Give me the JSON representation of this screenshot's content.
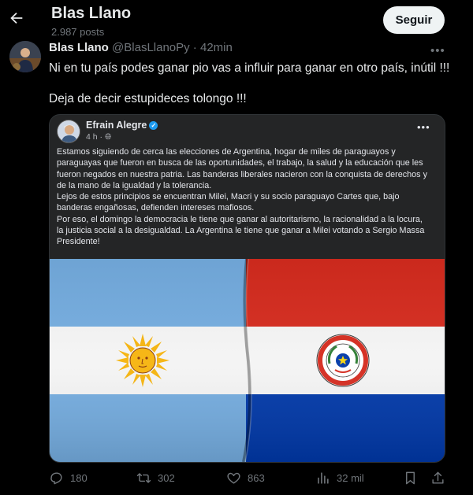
{
  "header": {
    "display_name": "Blas Llano",
    "post_count": "2.987 posts",
    "follow_label": "Seguir"
  },
  "tweet": {
    "author_name": "Blas Llano",
    "author_meta": "@BlasLlanoPy · 42min",
    "lines": [
      "Ni en tu país podes ganar pio vas a influir para ganar en otro país, inútil !!!",
      "Deja de decir estupideces tolongo !!!"
    ]
  },
  "embed": {
    "author_name": "Efrain Alegre",
    "time": "4 h · ",
    "lines": [
      "Estamos siguiendo de cerca las elecciones de Argentina, hogar de miles de paraguayos y",
      "paraguayas que fueron en busca de las oportunidades, el trabajo, la salud y la educación que les",
      "fueron negados en nuestra patria. Las banderas liberales nacieron con la conquista de derechos y",
      "de la mano de la igualdad y la tolerancia.",
      "Lejos de estos principios se encuentran Milei, Macri y su socio paraguayo Cartes que, bajo",
      "banderas engañosas, defienden intereses mafiosos.",
      "Por eso, el domingo la democracia le tiene que ganar al autoritarismo, la racionalidad a la locura,",
      "la justicia social a la desigualdad. La Argentina le tiene que ganar a Milei votando a Sergio Massa",
      "Presidente!"
    ],
    "seal_text": "REPUBLICA DEL PARAGUAY"
  },
  "actions": {
    "replies": "180",
    "reposts": "302",
    "likes": "863",
    "views": "32 mil"
  },
  "colors": {
    "background": "#000000",
    "text": "#e7e9ea",
    "muted": "#71767b",
    "argentina_blue": "#74acdf",
    "paraguay_red": "#d52b1e",
    "paraguay_blue": "#0038a8"
  },
  "icons": [
    "back-arrow-icon",
    "more-icon",
    "reply-icon",
    "repost-icon",
    "like-icon",
    "views-icon",
    "bookmark-icon",
    "share-icon",
    "verified-icon",
    "globe-icon",
    "sun-of-may-icon",
    "paraguay-seal-icon"
  ]
}
